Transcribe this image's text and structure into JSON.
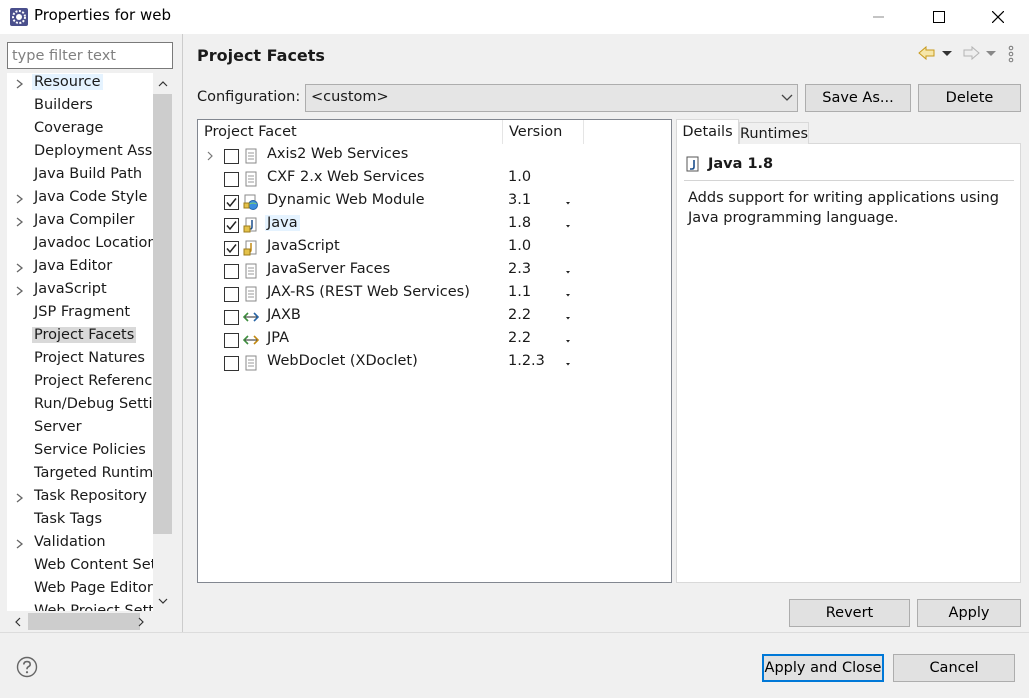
{
  "window": {
    "title": "Properties for web",
    "icons": {
      "app": "gear-window-icon",
      "minimize": "minimize-icon",
      "maximize": "maximize-icon",
      "close": "close-icon"
    }
  },
  "nav": {
    "filter_placeholder": "type filter text",
    "items": [
      {
        "label": "Resource",
        "expandable": true
      },
      {
        "label": "Builders",
        "expandable": false
      },
      {
        "label": "Coverage",
        "expandable": false
      },
      {
        "label": "Deployment Assem",
        "expandable": false
      },
      {
        "label": "Java Build Path",
        "expandable": false
      },
      {
        "label": "Java Code Style",
        "expandable": true
      },
      {
        "label": "Java Compiler",
        "expandable": true
      },
      {
        "label": "Javadoc Location",
        "expandable": false
      },
      {
        "label": "Java Editor",
        "expandable": true
      },
      {
        "label": "JavaScript",
        "expandable": true
      },
      {
        "label": "JSP Fragment",
        "expandable": false
      },
      {
        "label": "Project Facets",
        "expandable": false
      },
      {
        "label": "Project Natures",
        "expandable": false
      },
      {
        "label": "Project References",
        "expandable": false
      },
      {
        "label": "Run/Debug Settings",
        "expandable": false
      },
      {
        "label": "Server",
        "expandable": false
      },
      {
        "label": "Service Policies",
        "expandable": false
      },
      {
        "label": "Targeted Runtimes",
        "expandable": false
      },
      {
        "label": "Task Repository",
        "expandable": true
      },
      {
        "label": "Task Tags",
        "expandable": false
      },
      {
        "label": "Validation",
        "expandable": true
      },
      {
        "label": "Web Content Settings",
        "expandable": false
      },
      {
        "label": "Web Page Editor",
        "expandable": false
      },
      {
        "label": "Web Project Settings",
        "expandable": false
      }
    ]
  },
  "page": {
    "title": "Project Facets",
    "config_label": "Configuration:",
    "config_value": "<custom>",
    "save_as_label": "Save As...",
    "delete_label": "Delete",
    "revert_label": "Revert",
    "apply_label": "Apply"
  },
  "facets": {
    "headers": {
      "facet": "Project Facet",
      "version": "Version"
    },
    "rows": [
      {
        "name": "Axis2 Web Services",
        "version": "",
        "checked": false,
        "icon": "document-icon",
        "expandable": true,
        "dropdown": false
      },
      {
        "name": "CXF 2.x Web Services",
        "version": "1.0",
        "checked": false,
        "icon": "document-icon",
        "expandable": false,
        "dropdown": false
      },
      {
        "name": "Dynamic Web Module",
        "version": "3.1",
        "checked": true,
        "icon": "web-module-icon",
        "expandable": false,
        "dropdown": true
      },
      {
        "name": "Java",
        "version": "1.8",
        "checked": true,
        "icon": "java-lock-icon",
        "expandable": false,
        "dropdown": true
      },
      {
        "name": "JavaScript",
        "version": "1.0",
        "checked": true,
        "icon": "javascript-lock-icon",
        "expandable": false,
        "dropdown": false
      },
      {
        "name": "JavaServer Faces",
        "version": "2.3",
        "checked": false,
        "icon": "document-icon",
        "expandable": false,
        "dropdown": true
      },
      {
        "name": "JAX-RS (REST Web Services)",
        "version": "1.1",
        "checked": false,
        "icon": "document-icon",
        "expandable": false,
        "dropdown": true
      },
      {
        "name": "JAXB",
        "version": "2.2",
        "checked": false,
        "icon": "jaxb-arrows-icon",
        "expandable": false,
        "dropdown": true
      },
      {
        "name": "JPA",
        "version": "2.2",
        "checked": false,
        "icon": "jpa-arrows-icon",
        "expandable": false,
        "dropdown": true
      },
      {
        "name": "WebDoclet (XDoclet)",
        "version": "1.2.3",
        "checked": false,
        "icon": "document-icon",
        "expandable": false,
        "dropdown": true
      }
    ]
  },
  "details": {
    "tab_details": "Details",
    "tab_runtimes": "Runtimes",
    "title": "Java 1.8",
    "description": "Adds support for writing applications using Java programming language."
  },
  "footer": {
    "apply_close_label": "Apply and Close",
    "cancel_label": "Cancel"
  }
}
